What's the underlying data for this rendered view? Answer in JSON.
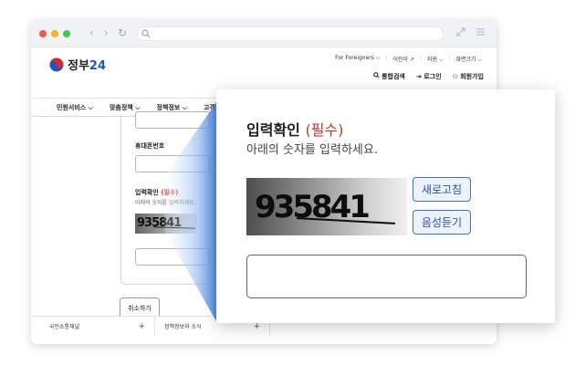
{
  "header": {
    "logo_text": "정부",
    "logo_num": "24",
    "util_links": [
      "For Foreigners ⌵",
      "어린이 ↗",
      "지원 ⌵",
      "화면크기 ⌵"
    ],
    "account_links": [
      "통합검색",
      "로그인",
      "회원가입"
    ]
  },
  "gnb": [
    "민원서비스 ⌵",
    "맞춤정책 ⌵",
    "정책정보 ⌵",
    "고객센터 ⌵"
  ],
  "form": {
    "phone_label": "휴대폰번호",
    "captcha_label": "입력확인",
    "required": "(필수)",
    "captcha_desc": "아래의 숫자를 입력하세요.",
    "captcha_code": "935841",
    "cancel_label": "취소하기"
  },
  "footer": [
    {
      "label": "국민소통채널",
      "icon": "+"
    },
    {
      "label": "정책정보와 소식",
      "icon": "+"
    }
  ],
  "zoom": {
    "title": "입력확인",
    "required": "(필수)",
    "desc": "아래의 숫자를 입력하세요.",
    "captcha_code": "935841",
    "refresh_label": "새로고침",
    "audio_label": "음성듣기"
  },
  "colors": {
    "accent": "#3f72c6",
    "required": "#c0392b",
    "beam": "#4a86e0"
  }
}
